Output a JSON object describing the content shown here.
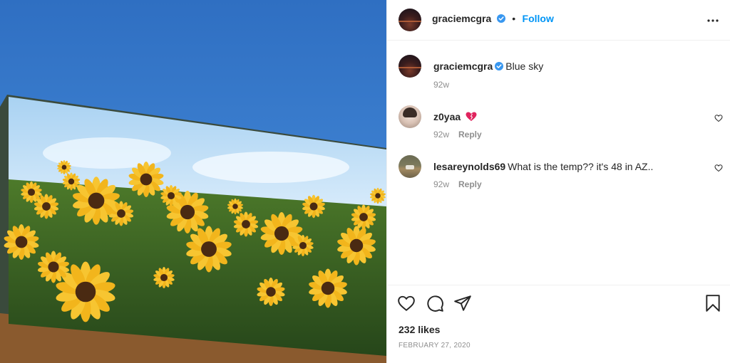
{
  "post": {
    "owner": {
      "username": "graciemcgra",
      "verified": true,
      "avatar_icon": "avatar-sunset"
    },
    "follow_label": "Follow",
    "separator": "•",
    "caption": "Blue sky",
    "caption_time": "92w",
    "likes": "232 likes",
    "date": "FEBRUARY 27, 2020"
  },
  "comments": [
    {
      "username": "z0yaa",
      "text": "",
      "emoji": "heart-emoji",
      "time": "92w",
      "reply_label": "Reply"
    },
    {
      "username": "lesareynolds69",
      "text": "What is the temp?? it's 48 in AZ..",
      "time": "92w",
      "reply_label": "Reply"
    }
  ],
  "colors": {
    "accent": "#0095f6",
    "verified": "#3897f0",
    "text": "#262626",
    "muted": "#8e8e8e",
    "sky": "#3c7fcf"
  }
}
